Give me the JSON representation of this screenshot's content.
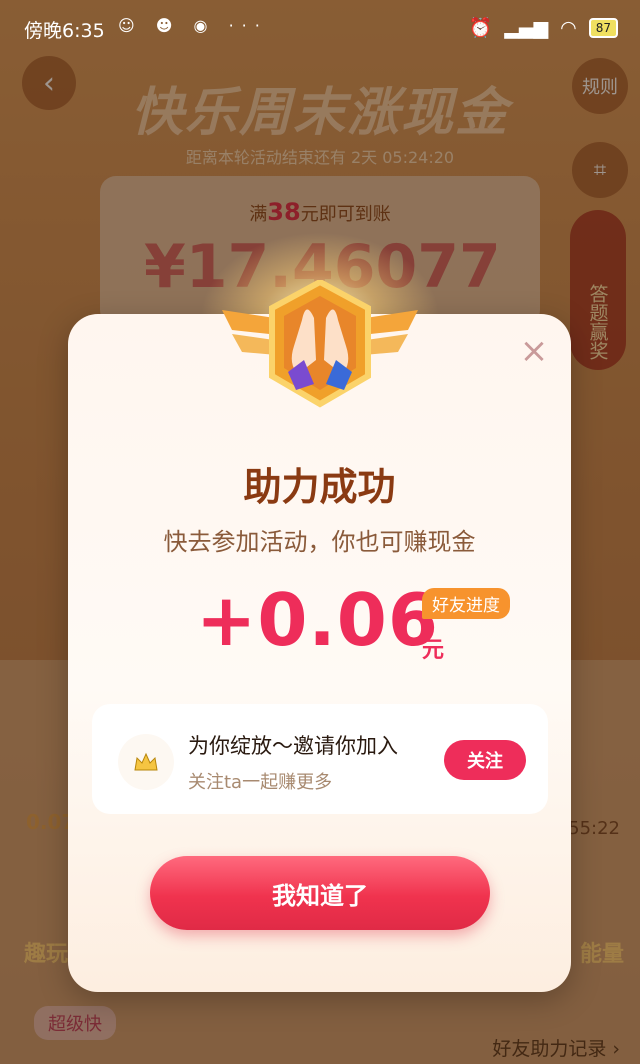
{
  "status_bar": {
    "time": "傍晚6:35",
    "extra": "···",
    "battery": "87"
  },
  "background": {
    "back_icon": "back-arrow-icon",
    "rules_label": "规则",
    "title": "快乐周末涨现金",
    "countdown": "距离本轮活动结束还有 2天 05:24:20",
    "need_prefix": "满",
    "need_amount": "38",
    "need_suffix": "元即可到账",
    "balance": "¥17.46077",
    "side_badge": "答题赢奖",
    "left_amount": "0.07",
    "right_time": "55:22",
    "left_label": "趣玩",
    "right_label": "能量",
    "bottom_left": "超级快",
    "bottom_right": "好友助力记录 ›"
  },
  "modal": {
    "close_icon": "close-icon",
    "title": "助力成功",
    "subtitle": "快去参加活动，你也可赚现金",
    "amount": "+0.06",
    "unit": "元",
    "progress_badge": "好友进度",
    "invite": {
      "title": "为你绽放～邀请你加入",
      "subtitle": "关注ta一起赚更多",
      "follow_label": "关注"
    },
    "confirm_label": "我知道了"
  },
  "colors": {
    "accent": "#ee2d5a",
    "title_brown": "#8a3a12",
    "badge_orange": "#f7932d"
  }
}
